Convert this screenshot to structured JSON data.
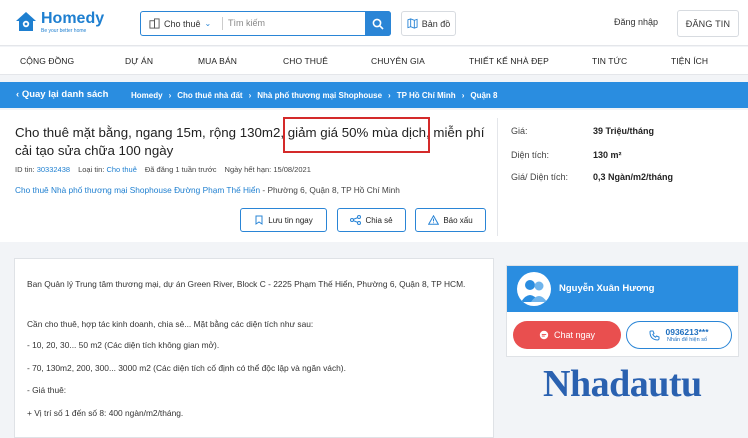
{
  "header": {
    "logo_name": "Homedy",
    "logo_slogan": "Be your better home",
    "search_type": "Cho thuê",
    "search_placeholder": "Tìm kiếm",
    "map_label": "Bản đồ",
    "login_label": "Đăng nhập",
    "post_label": "ĐĂNG TIN"
  },
  "nav": {
    "items": [
      "CỘNG ĐỒNG",
      "DỰ ÁN",
      "MUA BÁN",
      "CHO THUÊ",
      "CHUYÊN GIA",
      "THIẾT KẾ NHÀ ĐẸP",
      "TIN TỨC",
      "TIỆN ÍCH"
    ]
  },
  "breadcrumb": {
    "back_label": "Quay lại danh sách",
    "items": [
      "Homedy",
      "Cho thuê nhà đất",
      "Nhà phố thương mại Shophouse",
      "TP Hồ Chí Minh",
      "Quận 8"
    ]
  },
  "listing": {
    "title_before": "Cho thuê mặt bằng, ngang 15m, rộng 130m2, ",
    "title_highlight": "giảm giá 50% mùa dịch",
    "title_after": ", miễn phí cải tạo sửa chữa 100 ngày",
    "id_label": "ID tin:",
    "id_value": "30332438",
    "type_label": "Loại tin:",
    "type_value": "Cho thuê",
    "posted": "Đã đăng 1 tuần trước",
    "expiry": "Ngày hết hạn: 15/08/2021",
    "address_link": "Cho thuê Nhà phố thương mại Shophouse Đường Phạm Thế Hiển",
    "address_rest": " - Phường 6, Quận 8, TP Hồ Chí Minh",
    "actions": [
      "Lưu tin ngay",
      "Chia sẻ",
      "Báo xấu"
    ]
  },
  "facts": [
    {
      "label": "Giá:",
      "value": "39 Triệu/tháng"
    },
    {
      "label": "Diện tích:",
      "value": "130 m²"
    },
    {
      "label": "Giá/ Diện tích:",
      "value": "0,3 Ngàn/m2/tháng"
    }
  ],
  "description": [
    "Ban Quản lý Trung tâm thương mại, dự án Green River, Block C - 2225 Phạm Thế Hiển, Phường 6, Quận 8, TP HCM.",
    "Cần cho thuê, hợp tác kinh doanh, chia sẻ... Mặt bằng các diện tích như sau:",
    "- 10, 20, 30... 50 m2 (Các diện tích không gian mở).",
    "- 70, 130m2, 200, 300... 3000 m2 (Các diện tích cố định có thể độc lập và ngăn vách).",
    "- Giá thuê:",
    "+ Vị trí số 1 đến số 8: 400 ngàn/m2/tháng."
  ],
  "agent": {
    "name": "Nguyễn Xuân Hương",
    "chat_label": "Chat ngay",
    "phone": "0936213***",
    "phone_hint": "Nhấn để hiện số"
  },
  "watermark": "Nhadautu",
  "colors": {
    "primary": "#2a8de0",
    "highlight_box": "#d42a2a",
    "chat": "#e94f4f",
    "watermark": "#2a61b0"
  }
}
